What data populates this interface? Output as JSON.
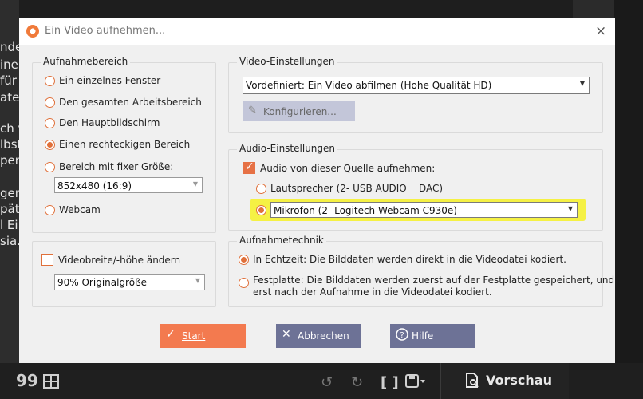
{
  "background": {
    "left_text_fragments": [
      "nde",
      "ine",
      "für",
      "ate",
      "ch v",
      "lbst",
      "pen",
      "gem",
      "päte",
      "l Ei",
      "sia."
    ],
    "toolbar_icons": [
      "quote-icon",
      "table-icon",
      "undo-icon",
      "redo-icon",
      "bracket-icon",
      "save-icon"
    ],
    "preview_label": "Vorschau"
  },
  "dialog": {
    "title": "Ein Video aufnehmen...",
    "close_glyph": "×"
  },
  "capture_area": {
    "title": "Aufnahmebereich",
    "options": [
      {
        "label": "Ein einzelnes Fenster",
        "selected": false
      },
      {
        "label": "Den gesamten Arbeitsbereich",
        "selected": false
      },
      {
        "label": "Den Hauptbildschirm",
        "selected": false
      },
      {
        "label": "Einen rechteckigen Bereich",
        "selected": true
      },
      {
        "label": "Bereich mit fixer Größe:",
        "selected": false
      },
      {
        "label": "Webcam",
        "selected": false
      }
    ],
    "fixed_size_value": "852x480 (16:9)"
  },
  "resize": {
    "checkbox_label": "Videobreite/-höhe ändern",
    "checked": false,
    "scale_value": "90% Originalgröße"
  },
  "video_settings": {
    "title": "Video-Einstellungen",
    "preset_value": "Vordefiniert: Ein Video abfilmen (Hohe Qualität HD)",
    "configure_label": "Konfigurieren..."
  },
  "audio_settings": {
    "title": "Audio-Einstellungen",
    "checkbox_label": "Audio von dieser Quelle aufnehmen:",
    "checked": true,
    "speaker_label": "Lautsprecher (2- USB AUDIO    DAC)",
    "mic_value": "Mikrofon (2- Logitech Webcam C930e)"
  },
  "technique": {
    "title": "Aufnahmetechnik",
    "realtime_label": "In Echtzeit: Die Bilddaten werden direkt in die Videodatei kodiert.",
    "disk_label_line1": "Festplatte: Die Bilddaten werden zuerst auf der Festplatte gespeichert, und",
    "disk_label_line2": "erst nach der Aufnahme in die Videodatei kodiert."
  },
  "buttons": {
    "start": "Start",
    "cancel": "Abbrechen",
    "help": "Hilfe"
  },
  "colors": {
    "accent": "#e0703a",
    "start_button": "#f37a4f",
    "secondary_button": "#6d7296",
    "highlight": "#f4f03a"
  }
}
